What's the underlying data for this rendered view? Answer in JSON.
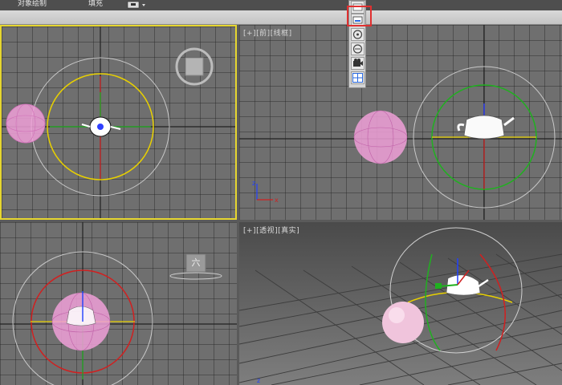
{
  "menu": {
    "object_paint": "对象绘制",
    "fill": "填充"
  },
  "viewports": {
    "top_left": {
      "label": "",
      "cube_text": ""
    },
    "front": {
      "label": "[+][前][线框]"
    },
    "left": {
      "label": "",
      "cube_text": "六"
    },
    "perspective": {
      "label": "[+][透视][真实]"
    }
  },
  "flyout": {
    "items": [
      "viewport-a-icon",
      "viewport-b-icon",
      "orbit-icon",
      "orbit-sub-icon",
      "camera-icon",
      "grid-icon"
    ]
  },
  "colors": {
    "active_border": "#e6d630",
    "highlight": "#e03030",
    "sphere": "#f0a0d8",
    "gizmo_yellow": "#e8d000",
    "gizmo_red": "#d02020",
    "gizmo_green": "#20b020",
    "gizmo_blue": "#2040ff"
  }
}
